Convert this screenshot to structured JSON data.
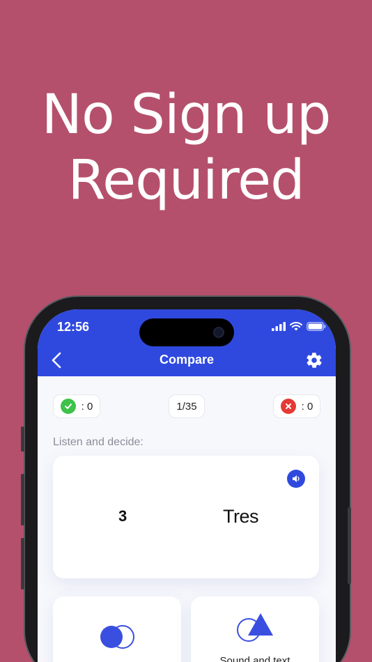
{
  "headline": {
    "line1": "No Sign up",
    "line2": "Required"
  },
  "status_bar": {
    "time": "12:56",
    "icons": [
      "signal-icon",
      "wifi-icon",
      "battery-icon"
    ]
  },
  "nav": {
    "title": "Compare",
    "back_icon": "chevron-left-icon",
    "settings_icon": "gear-icon"
  },
  "score": {
    "correct": ": 0",
    "progress": "1/35",
    "wrong": ": 0"
  },
  "prompt": "Listen and decide:",
  "card": {
    "left": "3",
    "right": "Tres",
    "audio_icon": "speaker-icon"
  },
  "options": [
    {
      "label": "",
      "icon": "overlap-circles-icon"
    },
    {
      "label": "Sound and text",
      "icon": "shapes-icon"
    }
  ],
  "colors": {
    "background": "#b5506c",
    "brand": "#2f49df",
    "correct": "#3ec24a",
    "wrong": "#e53935"
  }
}
